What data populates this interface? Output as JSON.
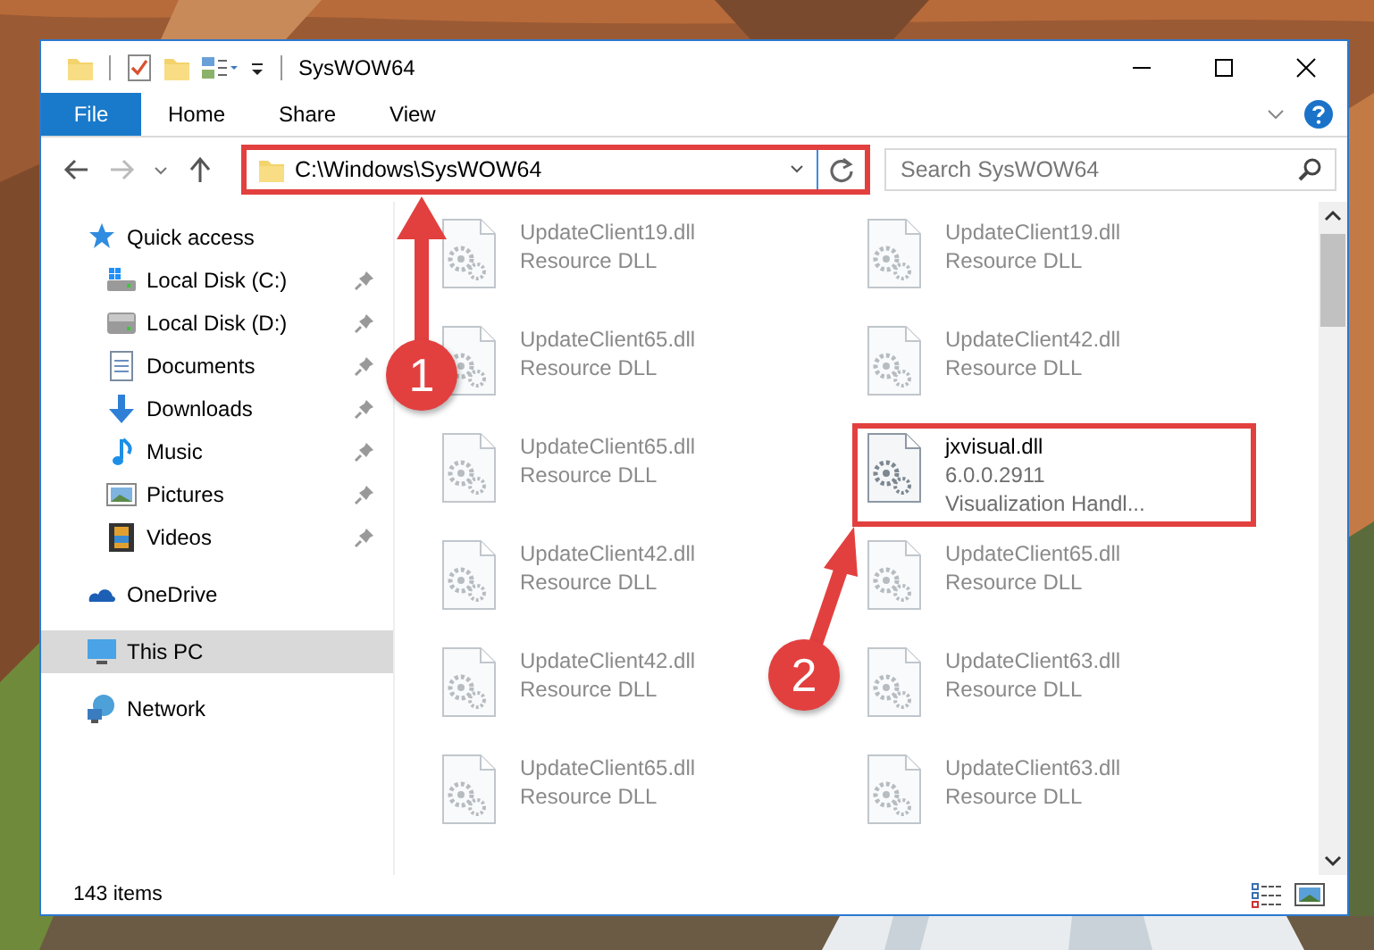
{
  "window": {
    "title": "SysWOW64"
  },
  "ribbon": {
    "tabs": [
      {
        "label": "File",
        "kind": "file"
      },
      {
        "label": "Home",
        "kind": "tab"
      },
      {
        "label": "Share",
        "kind": "tab"
      },
      {
        "label": "View",
        "kind": "tab"
      }
    ]
  },
  "address": {
    "path": "C:\\Windows\\SysWOW64",
    "highlighted": true
  },
  "search": {
    "placeholder": "Search SysWOW64"
  },
  "sidebar": {
    "items": [
      {
        "label": "Quick access",
        "selected": false,
        "children": [
          {
            "label": "Local Disk (C:)",
            "pinned": true,
            "selected": false
          },
          {
            "label": "Local Disk (D:)",
            "pinned": true,
            "selected": false
          },
          {
            "label": "Documents",
            "pinned": true,
            "selected": false
          },
          {
            "label": "Downloads",
            "pinned": true,
            "selected": false
          },
          {
            "label": "Music",
            "pinned": true,
            "selected": false
          },
          {
            "label": "Pictures",
            "pinned": true,
            "selected": false
          },
          {
            "label": "Videos",
            "pinned": true,
            "selected": false
          }
        ]
      },
      {
        "label": "OneDrive",
        "selected": false
      },
      {
        "label": "This PC",
        "selected": true
      },
      {
        "label": "Network",
        "selected": false
      }
    ]
  },
  "files": [
    {
      "name": "UpdateClient19.dll",
      "details": [
        "Resource DLL"
      ],
      "blurred": true,
      "highlighted": false
    },
    {
      "name": "UpdateClient19.dll",
      "details": [
        "Resource DLL"
      ],
      "blurred": true,
      "highlighted": false
    },
    {
      "name": "UpdateClient65.dll",
      "details": [
        "Resource DLL"
      ],
      "blurred": true,
      "highlighted": false
    },
    {
      "name": "UpdateClient42.dll",
      "details": [
        "Resource DLL"
      ],
      "blurred": true,
      "highlighted": false
    },
    {
      "name": "UpdateClient65.dll",
      "details": [
        "Resource DLL"
      ],
      "blurred": true,
      "highlighted": false
    },
    {
      "name": "jxvisual.dll",
      "details": [
        "6.0.0.2911",
        "Visualization Handl..."
      ],
      "blurred": false,
      "highlighted": true
    },
    {
      "name": "UpdateClient42.dll",
      "details": [
        "Resource DLL"
      ],
      "blurred": true,
      "highlighted": false
    },
    {
      "name": "UpdateClient65.dll",
      "details": [
        "Resource DLL"
      ],
      "blurred": true,
      "highlighted": false
    },
    {
      "name": "UpdateClient42.dll",
      "details": [
        "Resource DLL"
      ],
      "blurred": true,
      "highlighted": false
    },
    {
      "name": "UpdateClient63.dll",
      "details": [
        "Resource DLL"
      ],
      "blurred": true,
      "highlighted": false
    },
    {
      "name": "UpdateClient65.dll",
      "details": [
        "Resource DLL"
      ],
      "blurred": true,
      "highlighted": false
    },
    {
      "name": "UpdateClient63.dll",
      "details": [
        "Resource DLL"
      ],
      "blurred": true,
      "highlighted": false
    }
  ],
  "status_bar": {
    "count": "143 items"
  },
  "callouts": [
    {
      "number": "1"
    },
    {
      "number": "2"
    }
  ]
}
